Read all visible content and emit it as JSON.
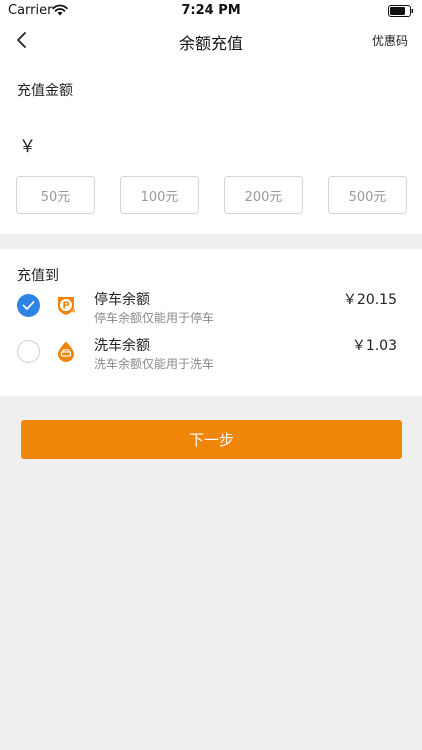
{
  "status_bar": {
    "carrier": "Carrier",
    "time": "7:24 PM"
  },
  "nav": {
    "title": "余额充值",
    "coupon_label": "优惠码"
  },
  "amount": {
    "label": "充值金额",
    "currency_symbol": "￥",
    "input_value": "",
    "options": [
      "50元",
      "100元",
      "200元",
      "500元"
    ]
  },
  "recharge_to": {
    "label": "充值到",
    "options": [
      {
        "title": "停车余额",
        "description": "停车余额仅能用于停车",
        "amount": "￥20.15",
        "selected": true,
        "icon": "parking-icon"
      },
      {
        "title": "洗车余额",
        "description": "洗车余额仅能用于洗车",
        "amount": "￥1.03",
        "selected": false,
        "icon": "car-wash-icon"
      }
    ]
  },
  "next_button_label": "下一步",
  "colors": {
    "accent": "#ef860a",
    "selected": "#2d83e6",
    "background": "#efefef"
  }
}
